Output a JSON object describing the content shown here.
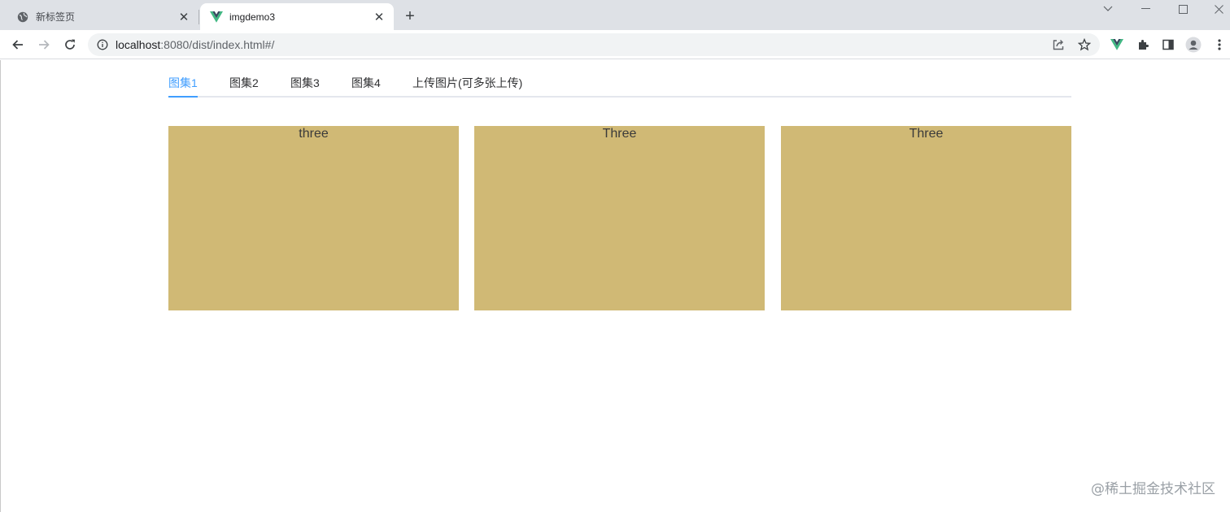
{
  "browser": {
    "tabs": [
      {
        "title": "新标签页",
        "active": false
      },
      {
        "title": "imgdemo3",
        "active": true
      }
    ],
    "url_host": "localhost",
    "url_path": ":8080/dist/index.html#/"
  },
  "nav": {
    "tabs": [
      {
        "label": "图集1",
        "active": true
      },
      {
        "label": "图集2",
        "active": false
      },
      {
        "label": "图集3",
        "active": false
      },
      {
        "label": "图集4",
        "active": false
      },
      {
        "label": "上传图片(可多张上传)",
        "active": false
      }
    ]
  },
  "cards": [
    {
      "label": "three"
    },
    {
      "label": "Three"
    },
    {
      "label": "Three"
    }
  ],
  "watermark": "@稀土掘金技术社区",
  "colors": {
    "accent": "#409eff",
    "card_bg": "#d0b975"
  }
}
